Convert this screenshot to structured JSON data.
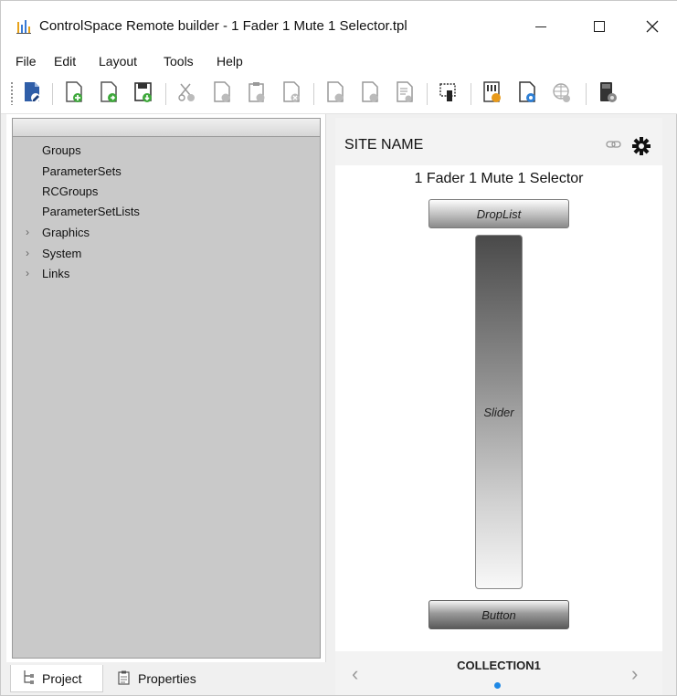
{
  "window": {
    "title": "ControlSpace Remote builder - 1 Fader 1 Mute 1 Selector.tpl",
    "icons": {
      "app": "app-logo-icon",
      "minimize": "minimize-icon",
      "maximize": "maximize-icon",
      "close": "close-icon"
    }
  },
  "menu": [
    "File",
    "Edit",
    "Layout",
    "Tools",
    "Help"
  ],
  "toolbar": {
    "buttons": [
      "edit-document-icon",
      "new-file-icon",
      "open-file-icon",
      "save-file-icon",
      "cut-icon",
      "copy-icon",
      "paste-icon",
      "delete-icon",
      "page-up-icon",
      "page-down-icon",
      "page-list-icon",
      "layout-select-icon",
      "fader-panel-icon",
      "preview-icon",
      "web-publish-icon",
      "device-icon"
    ]
  },
  "project_tree": {
    "items": [
      {
        "label": "Groups",
        "expandable": false
      },
      {
        "label": "ParameterSets",
        "expandable": false
      },
      {
        "label": "RCGroups",
        "expandable": false
      },
      {
        "label": "ParameterSetLists",
        "expandable": false
      },
      {
        "label": "Graphics",
        "expandable": true
      },
      {
        "label": "System",
        "expandable": true
      },
      {
        "label": "Links",
        "expandable": true
      }
    ]
  },
  "tabs": [
    {
      "label": "Project",
      "icon": "project-tree-icon",
      "active": true
    },
    {
      "label": "Properties",
      "icon": "properties-icon",
      "active": false
    }
  ],
  "preview": {
    "site_name": "SITE NAME",
    "panel_title": "1 Fader 1 Mute 1 Selector",
    "droplist_label": "DropList",
    "slider_label": "Slider",
    "button_label": "Button",
    "collection": "COLLECTION1",
    "page_indicator": {
      "count": 1,
      "current": 1
    }
  },
  "colors": {
    "accent_dot": "#1e88e5",
    "tree_background": "#c9c9c9"
  }
}
